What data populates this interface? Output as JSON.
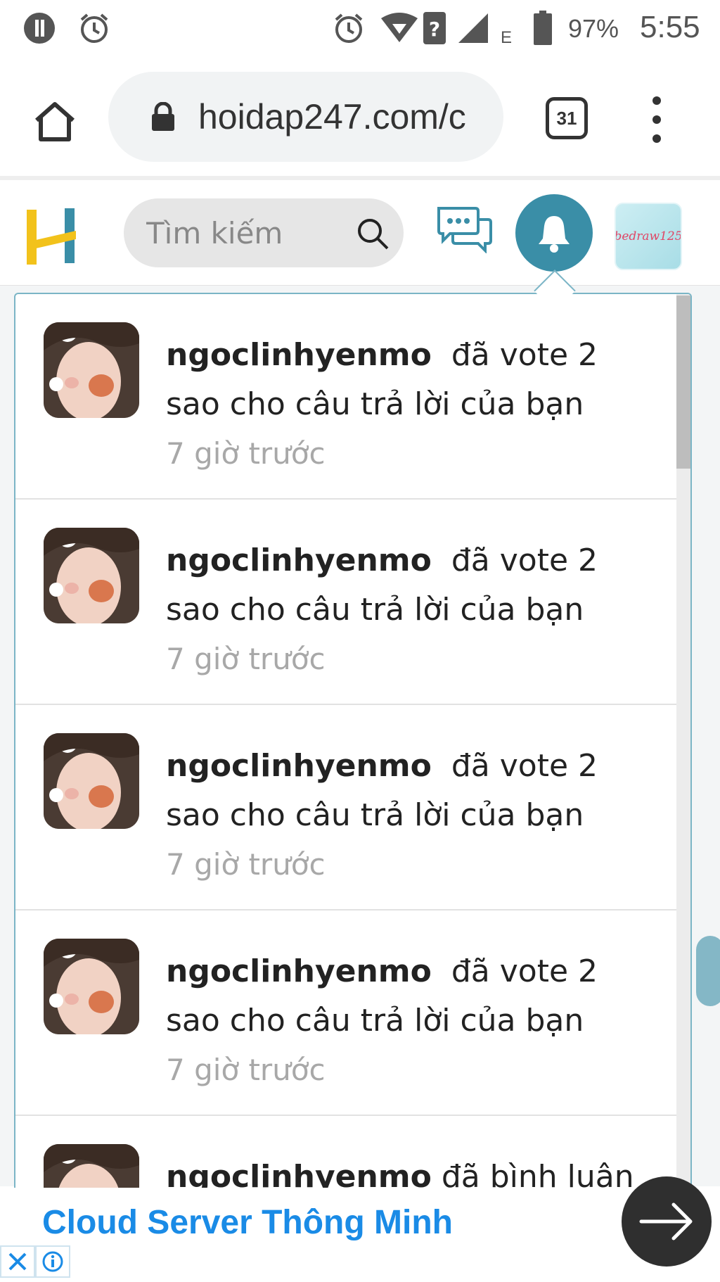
{
  "status_bar": {
    "battery": "97%",
    "time": "5:55",
    "network": "E",
    "icons": [
      "data-saver-icon",
      "alarm-icon",
      "alarm-icon",
      "wifi-icon",
      "unknown-network-icon",
      "signal-icon",
      "battery-icon"
    ]
  },
  "browser": {
    "url": "hoidap247.com/c",
    "tab_count": "31"
  },
  "header": {
    "search_placeholder": "Tìm kiếm",
    "user_avatar_text": "bedraw125",
    "accent_color": "#3a8ea7",
    "logo_colors": [
      "#f2c21b",
      "#3a8ea7"
    ]
  },
  "notifications": [
    {
      "user": "ngoclinhyenmo",
      "action": "đã vote 2",
      "detail": "sao cho câu trả lời của bạn",
      "time": "7 giờ trước"
    },
    {
      "user": "ngoclinhyenmo",
      "action": "đã vote 2",
      "detail": "sao cho câu trả lời của bạn",
      "time": "7 giờ trước"
    },
    {
      "user": "ngoclinhyenmo",
      "action": "đã vote 2",
      "detail": "sao cho câu trả lời của bạn",
      "time": "7 giờ trước"
    },
    {
      "user": "ngoclinhyenmo",
      "action": "đã vote 2",
      "detail": "sao cho câu trả lời của bạn",
      "time": "7 giờ trước"
    },
    {
      "user": "ngoclinhyenmo",
      "action": "đã bình luận",
      "detail": "",
      "time": ""
    }
  ],
  "ad": {
    "title": "Cloud Server Thông Minh",
    "color": "#1a8be6"
  }
}
